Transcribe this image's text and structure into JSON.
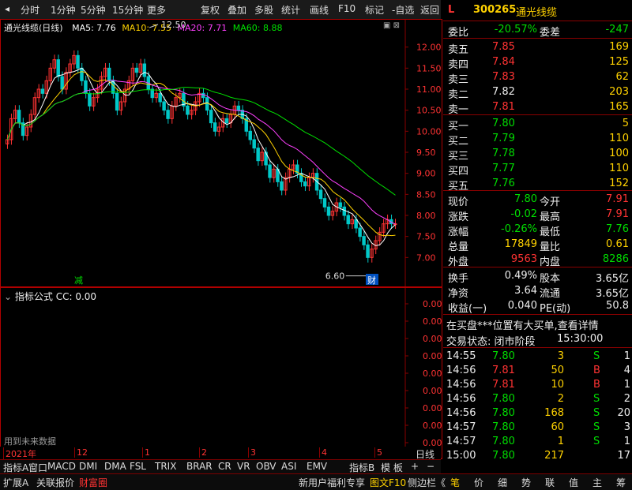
{
  "toolbar": {
    "left": [
      "分时",
      "1分钟",
      "5分钟",
      "15分钟",
      "更多"
    ],
    "right": [
      "复权",
      "叠加",
      "多股",
      "统计",
      "画线",
      "F10",
      "标记",
      "-自选",
      "返回"
    ]
  },
  "chart_header": {
    "title": "通光线缆(日线)",
    "ma5": "MA5: 7.76",
    "ma10": "MA10: 7.55",
    "ma20": "MA20: 7.71",
    "ma60": "MA60: 8.88"
  },
  "colors": {
    "ma5": "#ffffff",
    "ma10": "#ffd200",
    "ma20": "#ff40ff",
    "ma60": "#00e000",
    "up": "#ff3333",
    "down": "#00c8c8"
  },
  "annotations": {
    "high": "12.50",
    "low": "6.60",
    "mark_jian": "减",
    "mark_cai": "财"
  },
  "lower_panel": {
    "title": "指标公式  CC: 0.00",
    "ticks": [
      "0.00",
      "0.00",
      "0.00",
      "0.00",
      "0.00",
      "0.00",
      "0.00",
      "0.00",
      "0.00",
      "0.00"
    ],
    "footer": "用到未来数据"
  },
  "chart_data": {
    "type": "candlestick",
    "title": "通光线缆(日线)",
    "y_ticks": [
      "12.00",
      "11.50",
      "11.00",
      "10.50",
      "10.00",
      "9.50",
      "9.00",
      "8.50",
      "8.00",
      "7.50",
      "7.00"
    ],
    "ylim": [
      6.5,
      12.5
    ],
    "x_labels": [
      "2021年",
      "12",
      "1",
      "2",
      "3",
      "4",
      "5"
    ],
    "high_mark": 12.5,
    "low_mark": 6.6,
    "close": [
      9.8,
      10.3,
      10.5,
      10.2,
      9.9,
      10.1,
      10.4,
      10.8,
      11.0,
      10.9,
      11.2,
      11.5,
      11.7,
      11.3,
      11.0,
      11.4,
      11.6,
      11.8,
      11.5,
      11.2,
      10.9,
      10.6,
      10.8,
      11.0,
      11.3,
      11.5,
      11.2,
      10.9,
      10.5,
      10.7,
      11.0,
      11.2,
      11.5,
      11.4,
      11.6,
      11.3,
      11.0,
      10.8,
      10.9,
      10.7,
      10.5,
      10.3,
      10.6,
      10.8,
      10.9,
      10.6,
      10.4,
      10.5,
      10.7,
      10.9,
      10.8,
      10.5,
      10.2,
      10.0,
      10.1,
      10.3,
      10.2,
      10.4,
      10.6,
      10.5,
      10.3,
      10.0,
      9.8,
      9.6,
      9.3,
      9.5,
      9.2,
      8.9,
      9.1,
      8.8,
      8.6,
      8.9,
      9.1,
      9.2,
      9.0,
      8.8,
      8.7,
      8.9,
      9.0,
      8.6,
      8.4,
      8.2,
      8.0,
      8.1,
      8.3,
      8.2,
      8.0,
      7.8,
      7.9,
      7.7,
      7.5,
      7.3,
      7.0,
      7.2,
      7.4,
      7.6,
      7.8,
      7.9,
      7.8,
      7.8
    ]
  },
  "quote": {
    "code": "300265",
    "name": "通光线缆",
    "tag": "L",
    "webi_label": "委比",
    "webi": "-20.57%",
    "weicha_label": "委差",
    "weicha": "-247",
    "asks": [
      {
        "label": "卖五",
        "price": "7.85",
        "vol": "169"
      },
      {
        "label": "卖四",
        "price": "7.84",
        "vol": "125"
      },
      {
        "label": "卖三",
        "price": "7.83",
        "vol": "62"
      },
      {
        "label": "卖二",
        "price": "7.82",
        "vol": "203"
      },
      {
        "label": "卖一",
        "price": "7.81",
        "vol": "165"
      }
    ],
    "bids": [
      {
        "label": "买一",
        "price": "7.80",
        "vol": "5"
      },
      {
        "label": "买二",
        "price": "7.79",
        "vol": "110"
      },
      {
        "label": "买三",
        "price": "7.78",
        "vol": "100"
      },
      {
        "label": "买四",
        "price": "7.77",
        "vol": "110"
      },
      {
        "label": "买五",
        "price": "7.76",
        "vol": "152"
      }
    ],
    "stats": [
      {
        "l1": "现价",
        "v1": "7.80",
        "l2": "今开",
        "v2": "7.91"
      },
      {
        "l1": "涨跌",
        "v1": "-0.02",
        "l2": "最高",
        "v2": "7.91"
      },
      {
        "l1": "涨幅",
        "v1": "-0.26%",
        "l2": "最低",
        "v2": "7.76"
      },
      {
        "l1": "总量",
        "v1": "17849",
        "l2": "量比",
        "v2": "0.61"
      },
      {
        "l1": "外盘",
        "v1": "9563",
        "l2": "内盘",
        "v2": "8286"
      }
    ],
    "stats2": [
      {
        "l1": "换手",
        "v1": "0.49%",
        "l2": "股本",
        "v2": "3.65亿"
      },
      {
        "l1": "净资",
        "v1": "3.64",
        "l2": "流通",
        "v2": "3.65亿"
      },
      {
        "l1": "收益(一)",
        "v1": "0.040",
        "l2": "PE(动)",
        "v2": "50.8"
      }
    ],
    "notice": "在买盘***位置有大买单,查看详情",
    "trade_status": "交易状态: 闭市阶段",
    "trade_time": "15:30:00",
    "ticks": [
      {
        "t": "14:55",
        "p": "7.80",
        "v": "3",
        "s": "S",
        "n": "1"
      },
      {
        "t": "14:56",
        "p": "7.81",
        "v": "50",
        "s": "B",
        "n": "4"
      },
      {
        "t": "14:56",
        "p": "7.81",
        "v": "10",
        "s": "B",
        "n": "1"
      },
      {
        "t": "14:56",
        "p": "7.80",
        "v": "2",
        "s": "S",
        "n": "2"
      },
      {
        "t": "14:56",
        "p": "7.80",
        "v": "168",
        "s": "S",
        "n": "20"
      },
      {
        "t": "14:57",
        "p": "7.80",
        "v": "60",
        "s": "S",
        "n": "3"
      },
      {
        "t": "14:57",
        "p": "7.80",
        "v": "1",
        "s": "S",
        "n": "1"
      },
      {
        "t": "15:00",
        "p": "7.80",
        "v": "217",
        "s": "",
        "n": "17"
      }
    ]
  },
  "indicator_bar": {
    "tabs": [
      "指标A",
      "窗口",
      "MACD",
      "DMI",
      "DMA",
      "FSL",
      "TRIX",
      "BRAR",
      "CR",
      "VR",
      "OBV",
      "ASI",
      "EMV"
    ],
    "right": [
      "指标B",
      "模 板",
      "+",
      "−",
      "日线"
    ]
  },
  "bottom_bar": {
    "left": [
      "扩展A",
      "关联报价",
      "财富圈"
    ],
    "mid": [
      "新用户福利专享",
      "图文F10",
      "侧边栏《"
    ],
    "right": [
      "笔",
      "价",
      "细",
      "势",
      "联",
      "值",
      "主",
      "筹"
    ]
  }
}
